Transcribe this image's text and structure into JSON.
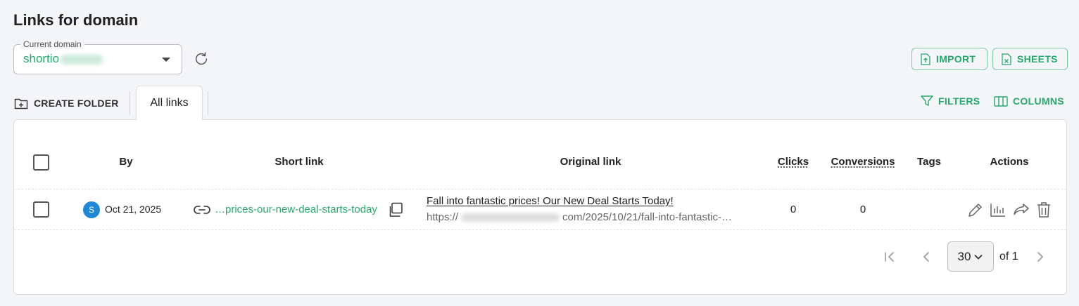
{
  "page": {
    "title": "Links for domain"
  },
  "domain": {
    "label": "Current domain",
    "value": "shortio"
  },
  "toolbar": {
    "import_label": "IMPORT",
    "sheets_label": "SHEETS",
    "create_folder_label": "CREATE FOLDER",
    "filters_label": "FILTERS",
    "columns_label": "COLUMNS"
  },
  "tabs": [
    {
      "label": "All links",
      "active": true
    }
  ],
  "table": {
    "headers": {
      "by": "By",
      "short_link": "Short link",
      "original_link": "Original link",
      "clicks": "Clicks",
      "conversions": "Conversions",
      "tags": "Tags",
      "actions": "Actions"
    },
    "rows": [
      {
        "avatar": "S",
        "date": "Oct 21, 2025",
        "short_link": "…prices-our-new-deal-starts-today",
        "original_title": "Fall into fantastic prices! Our New Deal Starts Today!",
        "original_url_prefix": "https://",
        "original_url_suffix": "com/2025/10/21/fall-into-fantastic-…",
        "clicks": "0",
        "conversions": "0",
        "tags": ""
      }
    ]
  },
  "pagination": {
    "per_page": "30",
    "of_label": "of 1"
  },
  "colors": {
    "accent": "#26a96c",
    "avatar": "#1e88d4",
    "background": "#f4f5f9"
  },
  "icons": [
    "refresh-icon",
    "upload-file-icon",
    "excel-file-icon",
    "folder-plus-icon",
    "filter-icon",
    "columns-icon",
    "link-icon",
    "copy-icon",
    "edit-icon",
    "stats-icon",
    "share-icon",
    "trash-icon",
    "first-page-icon",
    "prev-page-icon",
    "next-page-icon",
    "chevron-down-icon"
  ]
}
